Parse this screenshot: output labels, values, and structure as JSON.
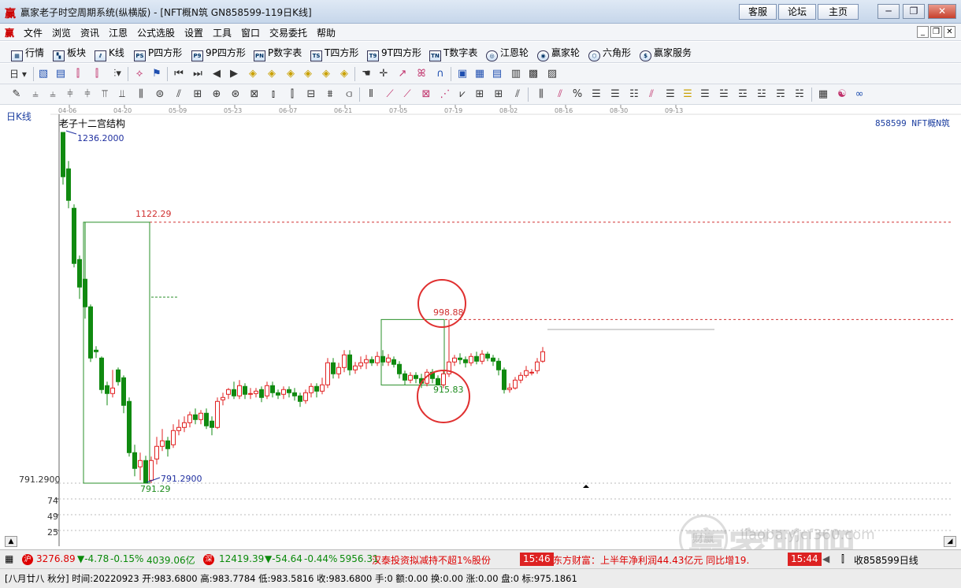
{
  "window": {
    "title": "赢家老子时空周期系统(纵横版) - [NFT概N筑  GN858599-119日K线]",
    "buttons": {
      "service": "客服",
      "forum": "论坛",
      "home": "主页"
    },
    "controls": {
      "minimize": "─",
      "restore": "❐",
      "close": "✕"
    }
  },
  "menu": {
    "items": [
      "文件",
      "浏览",
      "资讯",
      "江恩",
      "公式选股",
      "设置",
      "工具",
      "窗口",
      "交易委托",
      "帮助"
    ],
    "mdi": {
      "minimize": "_",
      "restore": "❐",
      "close": "✕"
    }
  },
  "toolbar1": {
    "items": [
      {
        "label": "行情",
        "icon": "table-icon",
        "glyph": "▦"
      },
      {
        "label": "板块",
        "icon": "blocks-icon",
        "glyph": "▚"
      },
      {
        "label": "K线",
        "icon": "candlestick-icon",
        "glyph": "⫽"
      },
      {
        "label": "P四方形",
        "icon": "p-square-icon",
        "glyph": "PS"
      },
      {
        "label": "9P四方形",
        "icon": "9p-square-icon",
        "glyph": "P9"
      },
      {
        "label": "P数字表",
        "icon": "p-number-table-icon",
        "glyph": "PN"
      },
      {
        "label": "T四方形",
        "icon": "t-square-icon",
        "glyph": "TS"
      },
      {
        "label": "9T四方形",
        "icon": "9t-square-icon",
        "glyph": "T9"
      },
      {
        "label": "T数字表",
        "icon": "t-number-table-icon",
        "glyph": "TN"
      },
      {
        "label": "江恩轮",
        "icon": "gann-wheel-icon",
        "glyph": "◎"
      },
      {
        "label": "赢家轮",
        "icon": "winner-wheel-icon",
        "glyph": "◉"
      },
      {
        "label": "六角形",
        "icon": "hexagon-icon",
        "glyph": "⬡"
      },
      {
        "label": "赢家服务",
        "icon": "dollar-icon",
        "glyph": "$"
      }
    ]
  },
  "toolbar2": {
    "period_label": "日"
  },
  "chart": {
    "period_label": "日K线",
    "study_label": "老子十二宫结构",
    "code_label": "858599 NFT概N筑",
    "date_ticks": [
      "04-06",
      "04-20",
      "05-09",
      "05-23",
      "06-07",
      "06-21",
      "07-05",
      "07-19",
      "08-02",
      "08-16",
      "08-30",
      "09-13"
    ],
    "high_label": "1236.2000",
    "level_1122": "1122.29",
    "level_998": "998.88",
    "level_915": "915.83",
    "low_label_right": "791.2900",
    "low_label_green": "791.29",
    "axis_labels": [
      "791.2900",
      "74",
      "49",
      "25"
    ],
    "colors": {
      "up": "#e02020",
      "down": "#108a10",
      "box": "#2a8f2a",
      "dash": "#d03030",
      "circle": "#e03030",
      "label_blue": "#2030a0"
    }
  },
  "statusbar": {
    "sh_badge": "沪",
    "sh_index": "3276.89",
    "sh_change": "▼-4.78",
    "sh_pct": "-0.15%",
    "sh_amount": "4039.06亿",
    "sz_badge": "深",
    "sz_index": "12419.39",
    "sz_change": "▼-54.64",
    "sz_pct": "-0.44%",
    "sz_amount": "5956.31",
    "news1": "汉泰投资拟减持不超1%股份",
    "time1": "15:46",
    "news2": "东方财富：上半年净利润44.43亿元 同比增19.",
    "time2": "15:44",
    "right_label": "收858599日线"
  },
  "infobar": {
    "text": "[八月廿八 秋分] 时间:20220923 开:983.6800 高:983.7784 低:983.5816 收:983.6800 手:0 额:0.00 换:0.00 涨:0.00 盘:0 标:975.1861"
  },
  "watermark": {
    "text": "赢家聊吧",
    "url": "liaoba.yjcf360.com",
    "seal": "财赢"
  },
  "candles": [
    [
      1236.2,
      1180,
      1236.2,
      1170
    ],
    [
      1190,
      1150,
      1200,
      1140
    ],
    [
      1140,
      1070,
      1145,
      1065
    ],
    [
      1075,
      1040,
      1080,
      1025
    ],
    [
      1050,
      1015,
      1122.29,
      1000
    ],
    [
      1015,
      950,
      1018,
      945
    ],
    [
      960,
      958,
      965,
      950
    ],
    [
      950,
      910,
      952,
      905
    ],
    [
      915,
      905,
      920,
      890
    ],
    [
      905,
      912,
      935,
      900
    ],
    [
      935,
      920,
      938,
      915
    ],
    [
      925,
      890,
      928,
      880
    ],
    [
      895,
      830,
      900,
      825
    ],
    [
      830,
      810,
      840,
      800
    ],
    [
      812,
      820,
      830,
      795
    ],
    [
      820,
      791.29,
      826,
      791.29
    ],
    [
      795,
      820,
      825,
      791.29
    ],
    [
      822,
      838,
      850,
      815
    ],
    [
      838,
      845,
      860,
      832
    ],
    [
      845,
      835,
      850,
      825
    ],
    [
      840,
      858,
      866,
      836
    ],
    [
      858,
      862,
      872,
      852
    ],
    [
      862,
      868,
      876,
      856
    ],
    [
      868,
      878,
      882,
      862
    ],
    [
      878,
      872,
      886,
      866
    ],
    [
      872,
      880,
      884,
      866
    ],
    [
      880,
      864,
      886,
      860
    ],
    [
      870,
      862,
      876,
      852
    ],
    [
      862,
      895,
      900,
      860
    ],
    [
      897,
      900,
      906,
      890
    ],
    [
      904,
      910,
      912,
      898
    ],
    [
      910,
      902,
      920,
      898
    ],
    [
      902,
      915,
      922,
      898
    ],
    [
      914,
      904,
      918,
      898
    ],
    [
      904,
      905,
      912,
      898
    ],
    [
      905,
      908,
      912,
      900
    ],
    [
      910,
      900,
      914,
      894
    ],
    [
      902,
      915,
      920,
      898
    ],
    [
      915,
      906,
      920,
      900
    ],
    [
      906,
      903,
      910,
      898
    ],
    [
      904,
      910,
      914,
      898
    ],
    [
      910,
      906,
      914,
      900
    ],
    [
      906,
      902,
      912,
      896
    ],
    [
      902,
      895,
      906,
      888
    ],
    [
      896,
      906,
      910,
      892
    ],
    [
      906,
      914,
      918,
      900
    ],
    [
      914,
      908,
      918,
      900
    ],
    [
      908,
      916,
      925,
      904
    ],
    [
      916,
      944,
      950,
      912
    ],
    [
      944,
      930,
      950,
      924
    ],
    [
      930,
      938,
      944,
      924
    ],
    [
      938,
      954,
      960,
      932
    ],
    [
      954,
      935,
      960,
      928
    ],
    [
      935,
      940,
      945,
      930
    ],
    [
      940,
      944,
      952,
      936
    ],
    [
      944,
      948,
      954,
      936
    ],
    [
      948,
      944,
      952,
      940
    ],
    [
      944,
      952,
      958,
      940
    ],
    [
      952,
      945,
      960,
      940
    ],
    [
      945,
      950,
      955,
      940
    ],
    [
      948,
      942,
      952,
      938
    ],
    [
      942,
      930,
      946,
      924
    ],
    [
      930,
      922,
      934,
      916
    ],
    [
      922,
      928,
      932,
      918
    ],
    [
      928,
      924,
      932,
      918
    ],
    [
      924,
      918,
      930,
      912
    ],
    [
      918,
      932,
      936,
      914
    ],
    [
      932,
      924,
      936,
      918
    ],
    [
      924,
      915.83,
      928,
      915.83
    ],
    [
      916,
      930,
      934,
      912
    ],
    [
      930,
      945,
      998.88,
      926
    ],
    [
      945,
      950,
      954,
      940
    ],
    [
      950,
      948,
      956,
      942
    ],
    [
      948,
      944,
      952,
      938
    ],
    [
      944,
      952,
      956,
      940
    ],
    [
      952,
      946,
      958,
      942
    ],
    [
      946,
      955,
      960,
      942
    ],
    [
      955,
      950,
      958,
      946
    ],
    [
      950,
      946,
      954,
      940
    ],
    [
      946,
      935,
      950,
      928
    ],
    [
      935,
      910,
      938,
      905
    ],
    [
      910,
      912,
      918,
      906
    ],
    [
      912,
      922,
      926,
      910
    ],
    [
      922,
      928,
      932,
      918
    ],
    [
      928,
      934,
      940,
      925
    ],
    [
      932,
      932,
      936,
      928
    ],
    [
      934,
      945,
      950,
      930
    ],
    [
      946,
      958,
      964,
      944
    ]
  ]
}
